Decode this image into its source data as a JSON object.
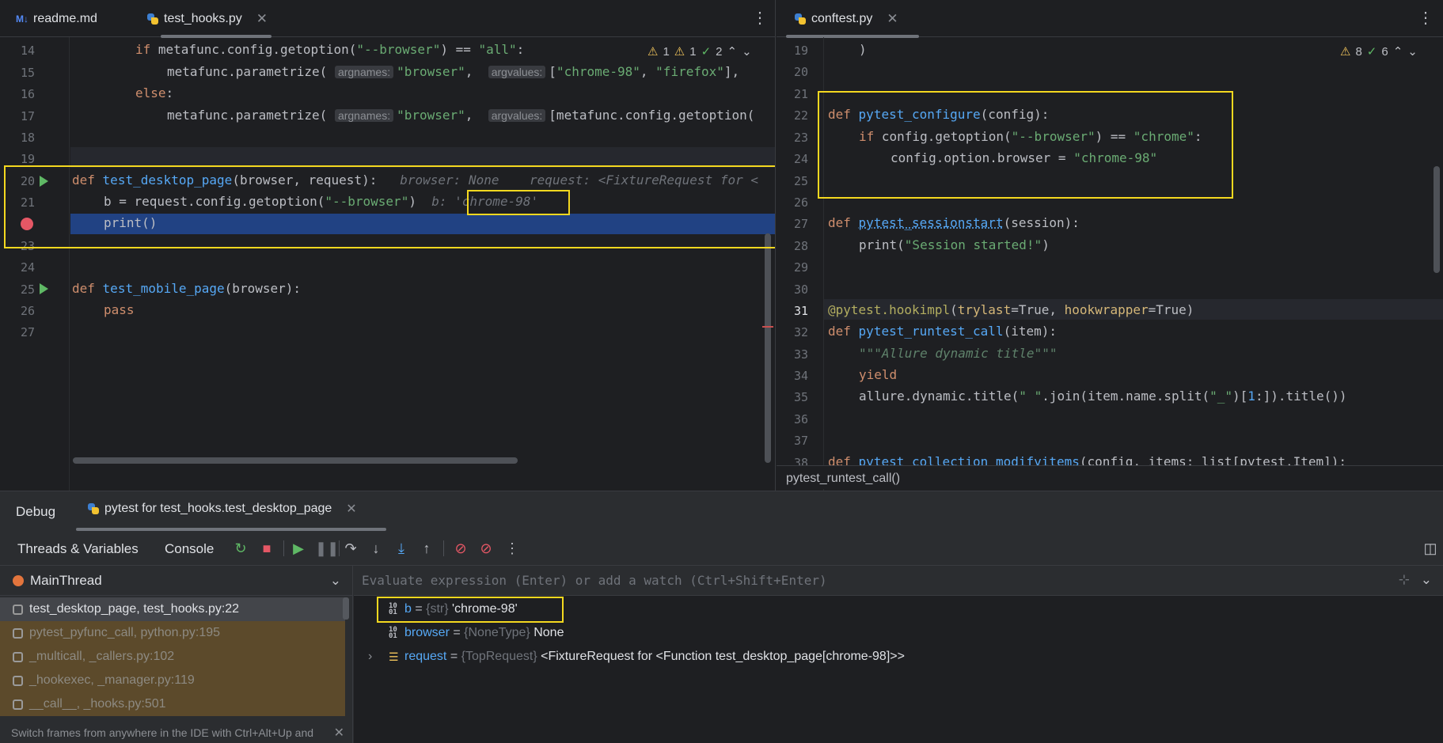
{
  "colors": {
    "annotation_box": "#f4d81f",
    "exec_line": "#214283",
    "breakpoint": "#e55765",
    "frames_bg": "#5c4a2b"
  },
  "left_editor": {
    "tabs": [
      {
        "icon": "M↓",
        "label": "readme.md"
      },
      {
        "icon": "python-icon",
        "label": "test_hooks.py",
        "close": "✕"
      }
    ],
    "more": "⋮",
    "inspection": {
      "warn1": "1",
      "warn2": "1",
      "ok": "2"
    },
    "line_numbers": [
      "14",
      "15",
      "16",
      "17",
      "18",
      "19",
      "20",
      "21",
      "",
      "23",
      "24",
      "25",
      "26",
      "27"
    ],
    "lines": {
      "l14_a": "if",
      "l14_b": " metafunc.config.getoption(",
      "l14_c": "\"--browser\"",
      "l14_d": ") == ",
      "l14_e": "\"all\"",
      "l14_f": ":",
      "l15_a": "metafunc.parametrize(",
      "l15_hint1": "argnames:",
      "l15_b": "\"browser\"",
      "l15_c": ",  ",
      "l15_hint2": "argvalues:",
      "l15_d": "[",
      "l15_e": "\"chrome-98\"",
      "l15_f": ", ",
      "l15_g": "\"firefox\"",
      "l15_h": "],",
      "l16_a": "else",
      "l16_b": ":",
      "l17_a": "metafunc.parametrize(",
      "l17_hint1": "argnames:",
      "l17_b": "\"browser\"",
      "l17_c": ",  ",
      "l17_hint2": "argvalues:",
      "l17_d": "[metafunc.config.getoption(",
      "l20_a": "def",
      "l20_b": "test_desktop_page",
      "l20_c": "(browser, request):",
      "l20_hint": "browser: None    request: <FixtureRequest for <",
      "l21_a": "b = request.config.getoption(",
      "l21_b": "\"--browser\"",
      "l21_c": ")",
      "l21_hint_label": "b:",
      "l21_hint_val": "'chrome-98'",
      "l22_a": "print()",
      "l25_a": "def",
      "l25_b": "test_mobile_page",
      "l25_c": "(browser):",
      "l26_a": "pass"
    }
  },
  "right_editor": {
    "tabs": [
      {
        "icon": "python-icon",
        "label": "conftest.py",
        "close": "✕"
      }
    ],
    "more": "⋮",
    "inspection": {
      "warn": "8",
      "ok": "6"
    },
    "line_numbers": [
      "19",
      "20",
      "21",
      "22",
      "23",
      "24",
      "25",
      "26",
      "27",
      "28",
      "29",
      "30",
      "31",
      "32",
      "33",
      "34",
      "35",
      "36",
      "37",
      "38"
    ],
    "lines": {
      "l19": ")",
      "l22_a": "def",
      "l22_b": "pytest_configure",
      "l22_c": "(config):",
      "l23_a": "if",
      "l23_b": " config.getoption(",
      "l23_c": "\"--browser\"",
      "l23_d": ") == ",
      "l23_e": "\"chrome\"",
      "l23_f": ":",
      "l24_a": "config.option.browser = ",
      "l24_b": "\"chrome-98\"",
      "l27_a": "def",
      "l27_b": "pytest_sessionstart",
      "l27_c": "(session):",
      "l28_a": "print(",
      "l28_b": "\"Session started!\"",
      "l28_c": ")",
      "l31_a": "@pytest.hookimpl",
      "l31_b": "(",
      "l31_c": "trylast",
      "l31_d": "=True, ",
      "l31_e": "hookwrapper",
      "l31_f": "=True)",
      "l32_a": "def",
      "l32_b": "pytest_runtest_call",
      "l32_c": "(item):",
      "l33_a": "\"\"\"Allure dynamic title\"\"\"",
      "l34_a": "yield",
      "l35_a": "allure.dynamic.title(",
      "l35_b": "\" \"",
      "l35_c": ".join(item.name.split(",
      "l35_d": "\"_\"",
      "l35_e": ")[",
      "l35_f": "1",
      "l35_g": ":]).title())",
      "l38_a": "def",
      "l38_b": "pytest_collection_modifyitems",
      "l38_c": "(config, items: list[pytest.Item]):"
    },
    "breadcrumb": "pytest_runtest_call()"
  },
  "debug": {
    "title": "Debug",
    "session_tab": "pytest for test_hooks.test_desktop_page",
    "close": "✕",
    "tabs": [
      "Threads & Variables",
      "Console"
    ],
    "thread": "MainThread",
    "frames": [
      "test_desktop_page, test_hooks.py:22",
      "pytest_pyfunc_call, python.py:195",
      "_multicall, _callers.py:102",
      "_hookexec, _manager.py:119",
      "__call__, _hooks.py:501"
    ],
    "frames_hint": "Switch frames from anywhere in the IDE with Ctrl+Alt+Up and",
    "eval_placeholder": "Evaluate expression (Enter) or add a watch (Ctrl+Shift+Enter)",
    "variables": [
      {
        "name": "b",
        "eq": " = ",
        "type": "{str}",
        "value": " 'chrome-98'"
      },
      {
        "name": "browser",
        "eq": " = ",
        "type": "{NoneType}",
        "value": " None"
      },
      {
        "name": "request",
        "eq": " = ",
        "type": "{TopRequest}",
        "value": " <FixtureRequest for <Function test_desktop_page[chrome-98]>>"
      }
    ]
  }
}
